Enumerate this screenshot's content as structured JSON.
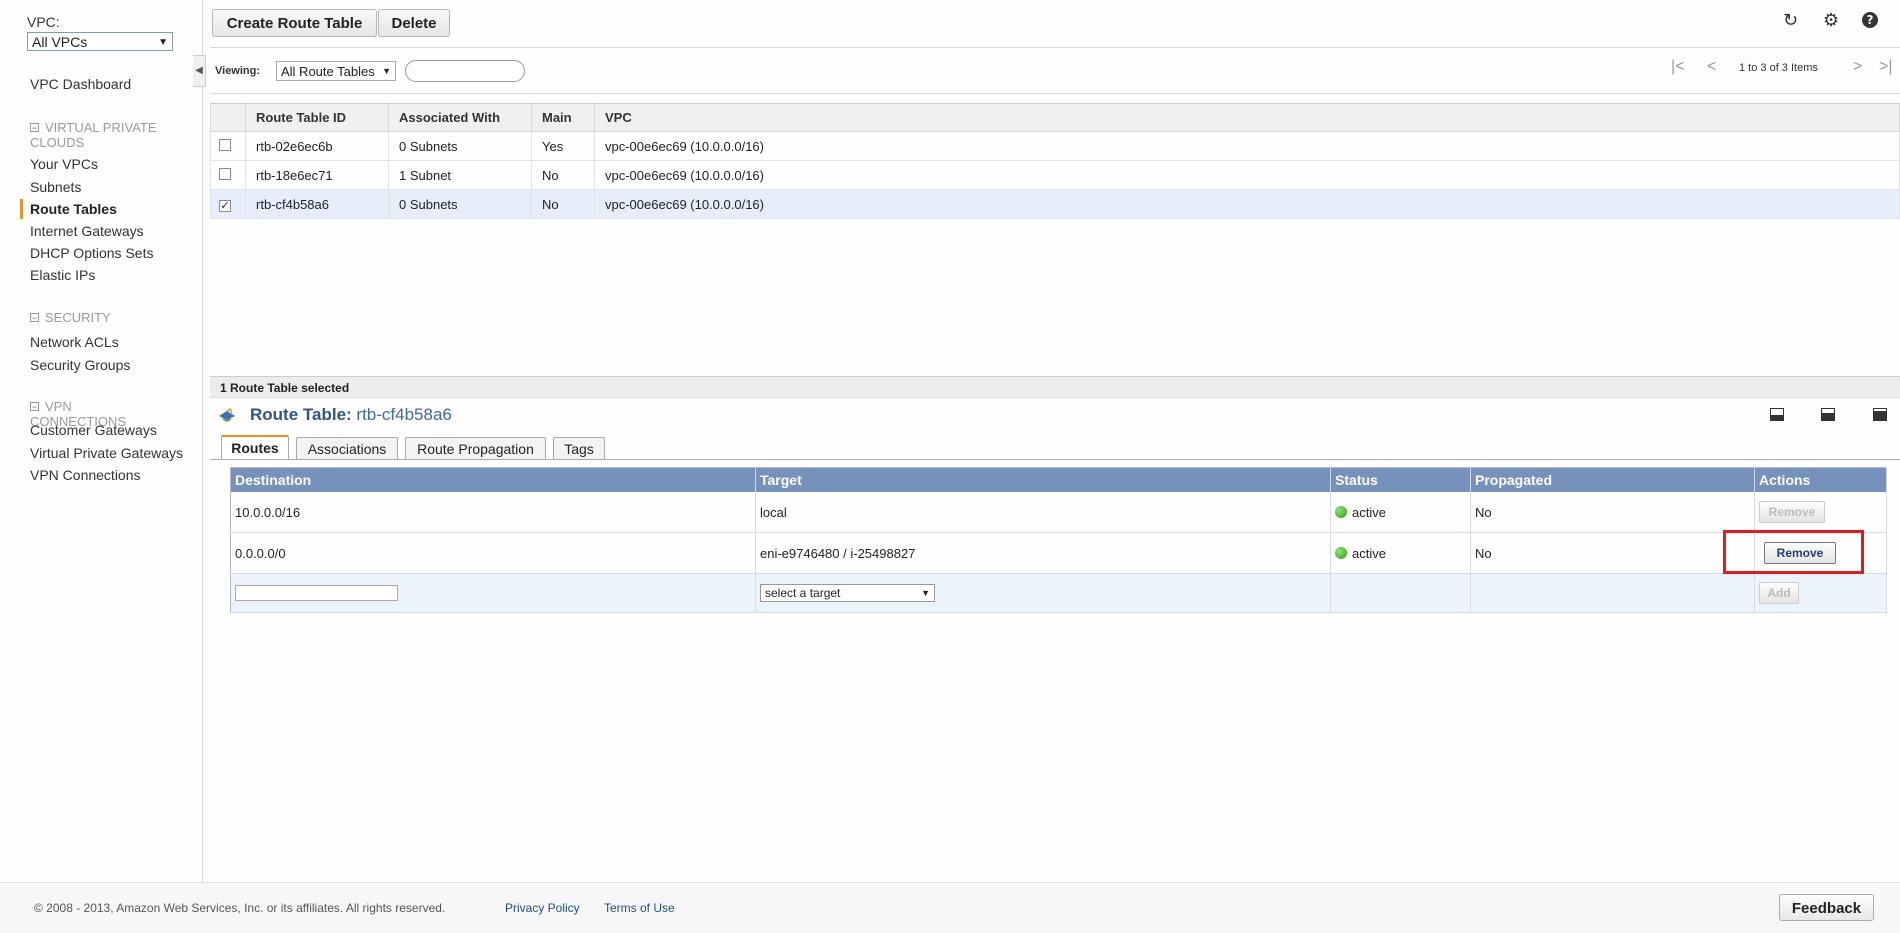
{
  "sidebar": {
    "vpc_label": "VPC:",
    "vpc_filter": "All VPCs",
    "dashboard": "VPC Dashboard",
    "sections": [
      {
        "title": "VIRTUAL PRIVATE CLOUDS",
        "items": [
          "Your VPCs",
          "Subnets",
          "Route Tables",
          "Internet Gateways",
          "DHCP Options Sets",
          "Elastic IPs"
        ]
      },
      {
        "title": "SECURITY",
        "items": [
          "Network ACLs",
          "Security Groups"
        ]
      },
      {
        "title": "VPN CONNECTIONS",
        "items": [
          "Customer Gateways",
          "Virtual Private Gateways",
          "VPN Connections"
        ]
      }
    ],
    "active_item": "Route Tables"
  },
  "toolbar": {
    "create_label": "Create Route Table",
    "delete_label": "Delete",
    "icons": [
      "refresh-icon",
      "gear-icon",
      "help-icon"
    ]
  },
  "viewing": {
    "label": "Viewing:",
    "filter": "All Route Tables",
    "search_value": "",
    "pager_text": "1 to 3 of 3 Items"
  },
  "route_tables": {
    "columns": [
      "Route Table ID",
      "Associated With",
      "Main",
      "VPC"
    ],
    "rows": [
      {
        "id": "rtb-02e6ec6b",
        "associated": "0 Subnets",
        "main": "Yes",
        "vpc": "vpc-00e6ec69 (10.0.0.0/16)",
        "checked": false
      },
      {
        "id": "rtb-18e6ec71",
        "associated": "1 Subnet",
        "main": "No",
        "vpc": "vpc-00e6ec69 (10.0.0.0/16)",
        "checked": false
      },
      {
        "id": "rtb-cf4b58a6",
        "associated": "0 Subnets",
        "main": "No",
        "vpc": "vpc-00e6ec69 (10.0.0.0/16)",
        "checked": true
      }
    ]
  },
  "detail": {
    "selection_text": "1 Route Table selected",
    "title_label": "Route Table:",
    "title_id": "rtb-cf4b58a6",
    "tabs": [
      "Routes",
      "Associations",
      "Route Propagation",
      "Tags"
    ],
    "active_tab": "Routes",
    "routes": {
      "columns": [
        "Destination",
        "Target",
        "Status",
        "Propagated",
        "Actions"
      ],
      "rows": [
        {
          "destination": "10.0.0.0/16",
          "target": "local",
          "status": "active",
          "propagated": "No",
          "action": "Remove",
          "action_enabled": false
        },
        {
          "destination": "0.0.0.0/0",
          "target": "eni-e9746480 / i-25498827",
          "status": "active",
          "propagated": "No",
          "action": "Remove",
          "action_enabled": true
        }
      ],
      "add_row": {
        "destination_value": "",
        "target_placeholder": "select a target",
        "add_label": "Add"
      }
    }
  },
  "footer": {
    "copyright": "© 2008 - 2013, Amazon Web Services, Inc. or its affiliates. All rights reserved.",
    "privacy": "Privacy Policy",
    "terms": "Terms of Use",
    "feedback": "Feedback"
  },
  "colors": {
    "accent": "#e8902a",
    "table_header": "#7791bd",
    "highlight": "#e8191c",
    "status_active": "#29a019"
  }
}
